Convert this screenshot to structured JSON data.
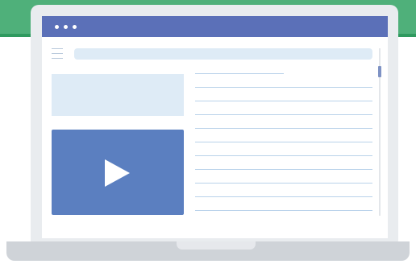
{
  "window": {
    "header_color": "#5b70b8",
    "controls": [
      "dot",
      "dot",
      "dot"
    ]
  },
  "toolbar": {
    "menu_icon": "hamburger-icon",
    "address_bar_value": ""
  },
  "main": {
    "left": {
      "content_box": "",
      "video_player": {
        "icon": "play-icon"
      }
    },
    "right": {
      "text_lines": [
        "",
        "",
        "",
        "",
        "",
        "",
        "",
        "",
        "",
        "",
        ""
      ]
    }
  },
  "colors": {
    "accent": "#5b70b8",
    "video": "#5b7fc0",
    "light_panel": "#deebf6",
    "line": "#b9d2ea",
    "band": "#4fb07a"
  }
}
